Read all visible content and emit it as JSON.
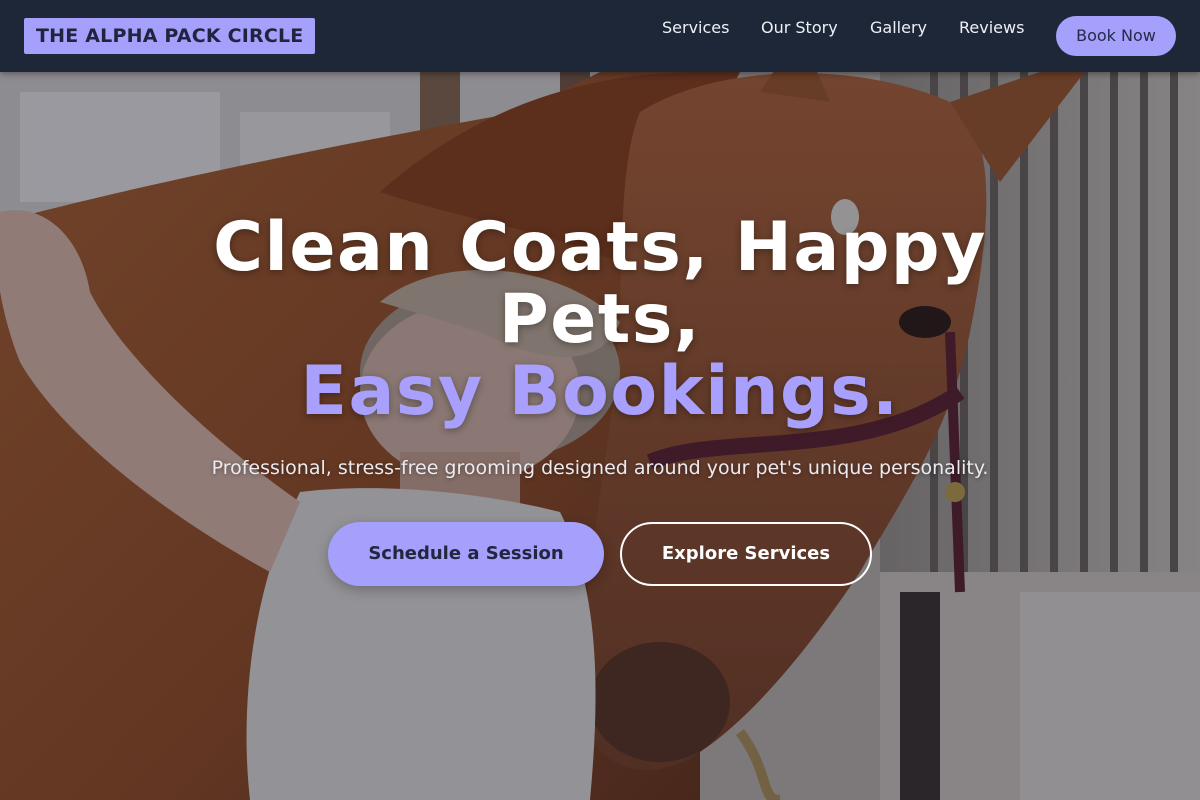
{
  "header": {
    "logo_text": "THE ALPHA PACK CIRCLE",
    "nav": [
      {
        "label": "Services"
      },
      {
        "label": "Our Story"
      },
      {
        "label": "Gallery"
      },
      {
        "label": "Reviews"
      }
    ],
    "book_label": "Book Now"
  },
  "hero": {
    "headline_line1": "Clean Coats, Happy",
    "headline_line2": "Pets,",
    "headline_accent": "Easy Bookings.",
    "subtitle": "Professional, stress-free grooming designed around your pet's unique personality.",
    "primary_cta": "Schedule a Session",
    "secondary_cta": "Explore Services",
    "background_image": "woman-hugging-horse-in-stable-photo"
  },
  "colors": {
    "header_bg": "#1e2738",
    "accent": "#a5a0fb",
    "headline_accent": "#a8a0fc",
    "text_light": "#ffffff"
  }
}
